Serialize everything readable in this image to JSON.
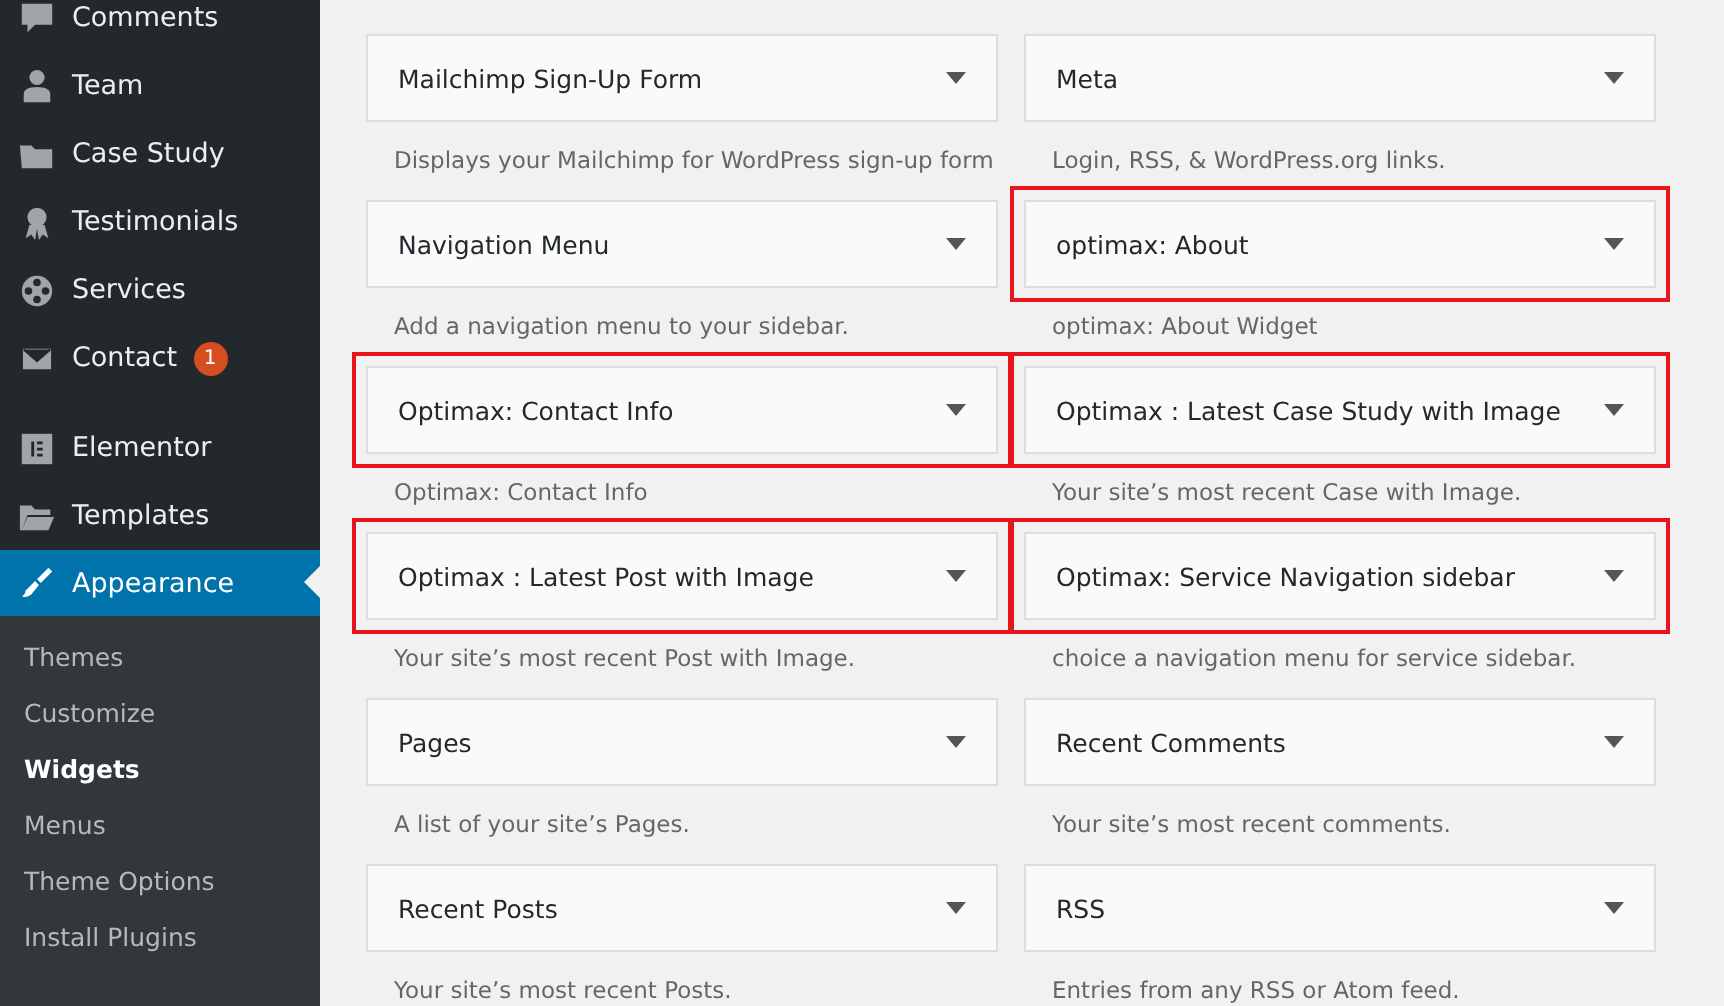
{
  "sidebar": {
    "groups": [
      [
        {
          "label": "Comments",
          "selected": false
        },
        {
          "label": "Team",
          "selected": false
        },
        {
          "label": "Case Study",
          "selected": false
        },
        {
          "label": "Testimonials",
          "selected": false
        },
        {
          "label": "Services",
          "selected": false
        },
        {
          "label": "Contact",
          "selected": false,
          "badge": "1"
        }
      ],
      [
        {
          "label": "Elementor",
          "selected": false
        },
        {
          "label": "Templates",
          "selected": false
        },
        {
          "label": "Appearance",
          "selected": true
        }
      ]
    ],
    "submenu": [
      {
        "label": "Themes",
        "selected": false
      },
      {
        "label": "Customize",
        "selected": false
      },
      {
        "label": "Widgets",
        "selected": true
      },
      {
        "label": "Menus",
        "selected": false
      },
      {
        "label": "Theme Options",
        "selected": false
      },
      {
        "label": "Install Plugins",
        "selected": false
      }
    ]
  },
  "widgets": [
    {
      "title": "Mailchimp Sign-Up Form",
      "description": "Displays your Mailchimp for WordPress sign-up form",
      "highlighted": false
    },
    {
      "title": "Meta",
      "description": "Login, RSS, & WordPress.org links.",
      "highlighted": false
    },
    {
      "title": "Navigation Menu",
      "description": "Add a navigation menu to your sidebar.",
      "highlighted": false
    },
    {
      "title": "optimax: About",
      "description": "optimax: About Widget",
      "highlighted": true
    },
    {
      "title": "Optimax: Contact Info",
      "description": "Optimax: Contact Info",
      "highlighted": true
    },
    {
      "title": "Optimax : Latest Case Study with Image",
      "description": "Your site’s most recent Case with Image.",
      "highlighted": true
    },
    {
      "title": "Optimax : Latest Post with Image",
      "description": "Your site’s most recent Post with Image.",
      "highlighted": true
    },
    {
      "title": "Optimax: Service Navigation sidebar",
      "description": "choice a navigation menu for service sidebar.",
      "highlighted": true
    },
    {
      "title": "Pages",
      "description": "A list of your site’s Pages.",
      "highlighted": false
    },
    {
      "title": "Recent Comments",
      "description": "Your site’s most recent comments.",
      "highlighted": false
    },
    {
      "title": "Recent Posts",
      "description": "Your site’s most recent Posts.",
      "highlighted": false
    },
    {
      "title": "RSS",
      "description": "Entries from any RSS or Atom feed.",
      "highlighted": false
    }
  ]
}
